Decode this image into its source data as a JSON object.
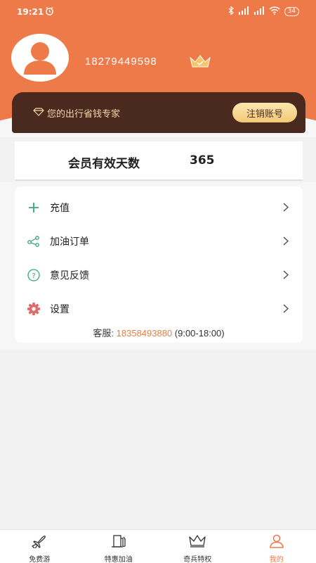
{
  "status": {
    "time": "19:21",
    "battery": "34"
  },
  "profile": {
    "phone": "18279449598"
  },
  "vip": {
    "tagline": "您的出行省钱专家",
    "cancel_label": "注销账号"
  },
  "membership": {
    "label": "会员有效天数",
    "days": "365"
  },
  "menu": [
    {
      "label": "充值",
      "icon": "plus-icon"
    },
    {
      "label": "加油订单",
      "icon": "share-nodes-icon"
    },
    {
      "label": "意见反馈",
      "icon": "question-icon"
    },
    {
      "label": "设置",
      "icon": "gear-icon"
    }
  ],
  "service": {
    "prefix": "客服:",
    "phone": "18358493880",
    "hours": "(9:00-18:00)"
  },
  "tabs": [
    {
      "label": "免费游",
      "icon": "plane-icon",
      "active": false
    },
    {
      "label": "特惠加油",
      "icon": "fuel-icon",
      "active": false
    },
    {
      "label": "奇兵特权",
      "icon": "crown-icon",
      "active": false
    },
    {
      "label": "我的",
      "icon": "person-icon",
      "active": true
    }
  ],
  "colors": {
    "accent": "#ee7a4a",
    "vip_bg": "#4a2a1e",
    "gold": "#f4d8a8",
    "service_phone": "#e0804a"
  }
}
